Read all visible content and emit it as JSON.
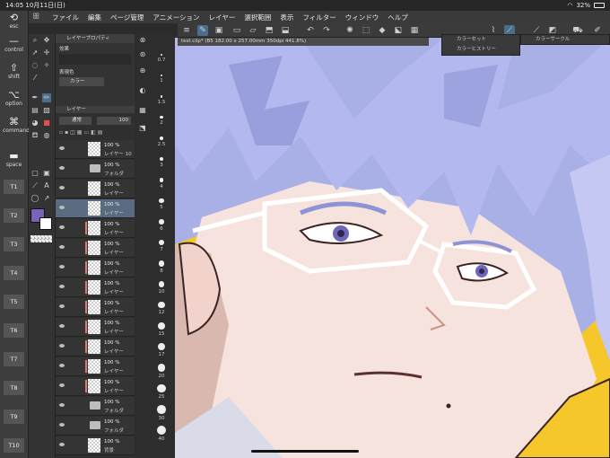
{
  "status": {
    "time": "14:05",
    "date": "10月11日(日)",
    "battery": "32%"
  },
  "menu": [
    "ファイル",
    "編集",
    "ページ管理",
    "アニメーション",
    "レイヤー",
    "選択範囲",
    "表示",
    "フィルター",
    "ウィンドウ",
    "ヘルプ"
  ],
  "rail": {
    "esc": "esc",
    "control": "control",
    "shift": "shift",
    "option": "option",
    "command": "command",
    "space": "space",
    "keys": [
      "T1",
      "T2",
      "T3",
      "T4",
      "T5",
      "T6",
      "T7",
      "T8",
      "T9",
      "T10"
    ]
  },
  "document_tab": "test.clip* (B5 182.00 x 257.00mm 350dpi 441.8%)",
  "props": {
    "title": "レイヤープロパティ",
    "effect": "効果",
    "color_label": "表現色",
    "color_value": "カラー"
  },
  "layer_panel": {
    "title": "レイヤー",
    "blend": "通常",
    "opacity": "100",
    "rows": [
      {
        "pct": "100 %",
        "name": "レイヤー 10",
        "type": "layer"
      },
      {
        "pct": "100 %",
        "name": "フォルダ",
        "type": "folder"
      },
      {
        "pct": "100 %",
        "name": "レイヤー",
        "type": "layer"
      },
      {
        "pct": "100 %",
        "name": "レイヤー",
        "type": "layer",
        "selected": true
      },
      {
        "pct": "100 %",
        "name": "レイヤー",
        "type": "layer",
        "mask": true
      },
      {
        "pct": "100 %",
        "name": "レイヤー",
        "type": "layer",
        "mask": true
      },
      {
        "pct": "100 %",
        "name": "レイヤー",
        "type": "layer",
        "mask": true
      },
      {
        "pct": "100 %",
        "name": "レイヤー",
        "type": "layer",
        "mask": true
      },
      {
        "pct": "100 %",
        "name": "レイヤー",
        "type": "layer",
        "mask": true
      },
      {
        "pct": "100 %",
        "name": "レイヤー",
        "type": "layer",
        "mask": true
      },
      {
        "pct": "100 %",
        "name": "レイヤー",
        "type": "layer",
        "mask": true
      },
      {
        "pct": "100 %",
        "name": "レイヤー",
        "type": "layer",
        "mask": true
      },
      {
        "pct": "100 %",
        "name": "レイヤー",
        "type": "layer",
        "mask": true
      },
      {
        "pct": "100 %",
        "name": "フォルダ",
        "type": "folder"
      },
      {
        "pct": "100 %",
        "name": "フォルダ",
        "type": "folder"
      },
      {
        "pct": "100 %",
        "name": "背景",
        "type": "layer"
      }
    ]
  },
  "brush_sizes": [
    "0.7",
    "1",
    "1.5",
    "2",
    "2.5",
    "3",
    "4",
    "5",
    "6",
    "7",
    "8",
    "10",
    "12",
    "15",
    "17",
    "20",
    "25",
    "30",
    "40"
  ],
  "subpanels": {
    "color_set": "カラーセット",
    "color_history": "カラーヒストリー",
    "color_circle": "カラーサークル"
  },
  "colors": {
    "main": "#7a62b8",
    "sub": "#ffffff",
    "canvas_bg": "#f5c72a",
    "accent": "#4b6e8e"
  }
}
